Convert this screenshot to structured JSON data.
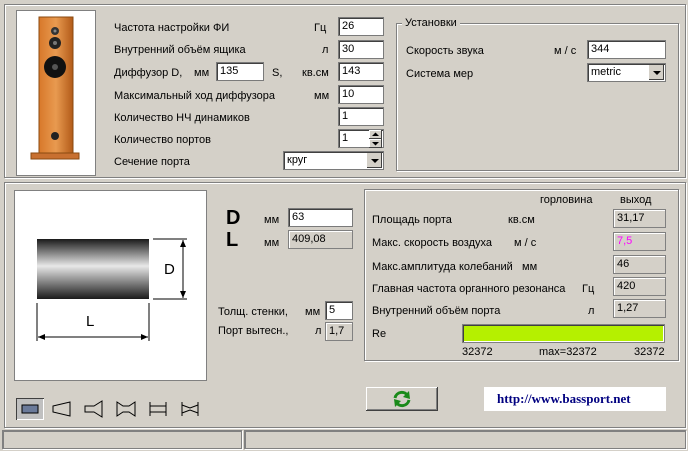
{
  "params": {
    "tuning_freq": {
      "label": "Частота настройки ФИ",
      "unit": "Гц",
      "value": "26"
    },
    "box_volume": {
      "label": "Внутренний объём ящика",
      "unit": "л",
      "value": "30"
    },
    "diffuser": {
      "label": "Диффузор D,",
      "unit_mm": "мм",
      "d_value": "135",
      "s_label": "S,",
      "s_unit": "кв.см",
      "s_value": "143"
    },
    "max_stroke": {
      "label": "Максимальный ход диффузора",
      "unit": "мм",
      "value": "10"
    },
    "woofer_count": {
      "label": "Количество НЧ динамиков",
      "value": "1"
    },
    "port_count": {
      "label": "Количество портов",
      "value": "1"
    },
    "port_section": {
      "label": "Сечение порта",
      "value": "круг"
    }
  },
  "settings": {
    "title": "Установки",
    "sound_speed": {
      "label": "Скорость звука",
      "unit": "м / с",
      "value": "344"
    },
    "units": {
      "label": "Система мер",
      "value": "metric"
    }
  },
  "port_dims": {
    "D": {
      "letter": "D",
      "unit": "мм",
      "value": "63"
    },
    "L": {
      "letter": "L",
      "unit": "мм",
      "value": "409,08"
    },
    "drawing_D": "D",
    "drawing_L": "L",
    "wall": {
      "label": "Толщ. стенки,",
      "unit": "мм",
      "value": "5"
    },
    "displaced": {
      "label": "Порт вытесн.,",
      "unit": "л",
      "value": "1,7"
    }
  },
  "results": {
    "col_throat": "горловина",
    "col_exit": "выход",
    "port_area": {
      "label": "Площадь порта",
      "unit": "кв.см",
      "value": "31,17"
    },
    "air_speed": {
      "label": "Макс. скорость воздуха",
      "unit": "м / с",
      "value": "7,5"
    },
    "amplitude": {
      "label": "Макс.амплитуда колебаний",
      "unit": "мм",
      "value": "46"
    },
    "organ_freq": {
      "label": "Главная частота органного резонанса",
      "unit": "Гц",
      "value": "420"
    },
    "port_volume": {
      "label": "Внутренний объём порта",
      "unit": "л",
      "value": "1,27"
    },
    "re": {
      "label": "Re",
      "left": "32372",
      "max": "max=32372",
      "right": "32372",
      "fill_fraction": 1.0
    }
  },
  "link": "http://www.bassport.net",
  "colors": {
    "bar_fill": "#b5f000",
    "speed_value": "#ff00ff",
    "link": "#000080",
    "refresh": "#1a8a1a"
  },
  "toolbar": [
    "straight-port-icon",
    "flared-port-icon",
    "horn-port-icon",
    "double-flare-icon",
    "straight-flange-icon",
    "double-taper-icon"
  ]
}
